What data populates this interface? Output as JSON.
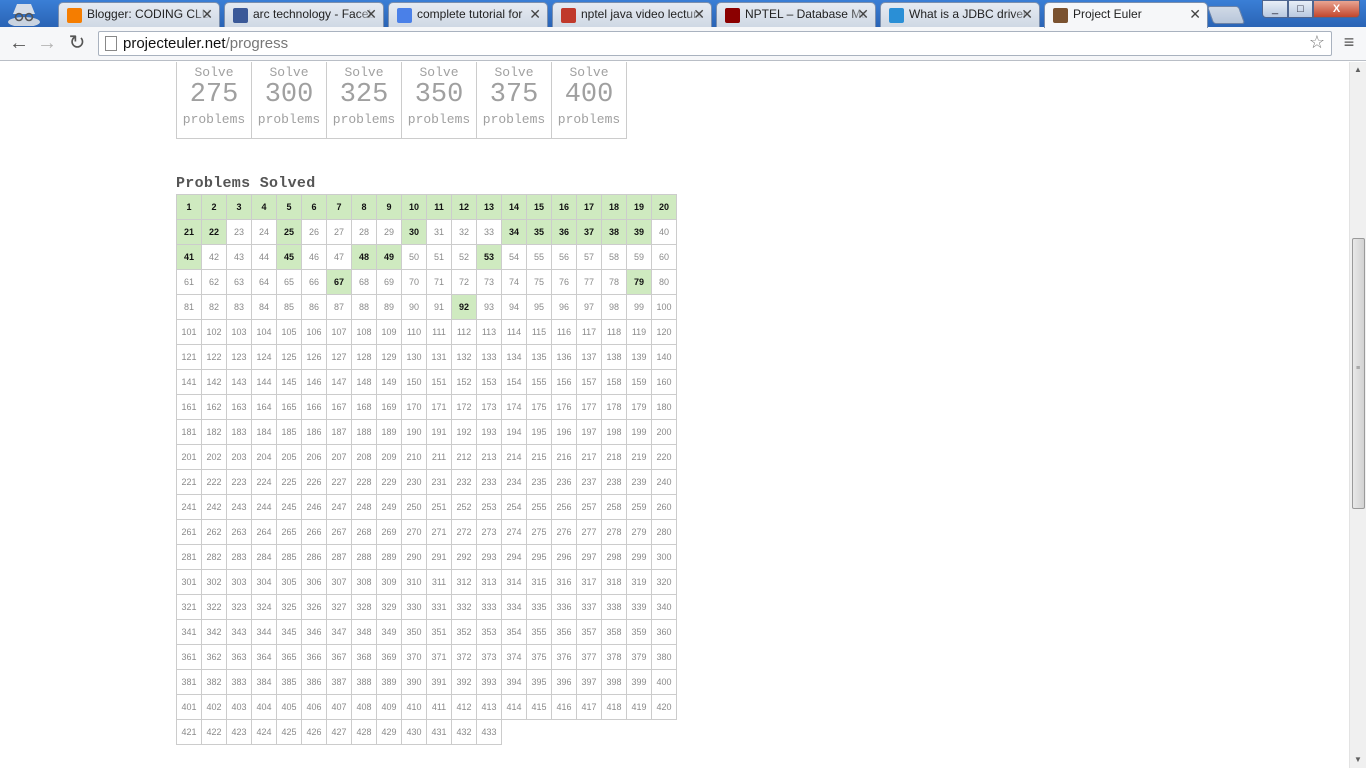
{
  "browser": {
    "tabs": [
      {
        "title": "Blogger: CODING CLUB",
        "favicon": "blogger-icon",
        "color": "#f57d00",
        "active": false
      },
      {
        "title": "arc technology - Facebook",
        "favicon": "facebook-icon",
        "color": "#3b5998",
        "active": false
      },
      {
        "title": "complete tutorial for",
        "favicon": "google-icon",
        "color": "#4a80e8",
        "active": false
      },
      {
        "title": "nptel java video lecture",
        "favicon": "video-icon",
        "color": "#c0392b",
        "active": false
      },
      {
        "title": "NPTEL – Database Management",
        "favicon": "nptel-icon",
        "color": "#8b0000",
        "active": false
      },
      {
        "title": "What is a JDBC driver",
        "favicon": "cloud-icon",
        "color": "#2a8fd6",
        "active": false
      },
      {
        "title": "Project Euler",
        "favicon": "project-euler-icon",
        "color": "#7a5230",
        "active": true
      }
    ],
    "tab_close_glyph": "✕",
    "url_host": "projecteuler.net",
    "url_path": "/progress",
    "back_glyph": "←",
    "forward_glyph": "→",
    "reload_glyph": "↻",
    "star_glyph": "☆",
    "menu_glyph": "≡",
    "window": {
      "minimize": "_",
      "maximize": "□",
      "close": "X"
    }
  },
  "milestones": [
    {
      "label_top": "Solve",
      "number": "275",
      "label_bottom": "problems"
    },
    {
      "label_top": "Solve",
      "number": "300",
      "label_bottom": "problems"
    },
    {
      "label_top": "Solve",
      "number": "325",
      "label_bottom": "problems"
    },
    {
      "label_top": "Solve",
      "number": "350",
      "label_bottom": "problems"
    },
    {
      "label_top": "Solve",
      "number": "375",
      "label_bottom": "problems"
    },
    {
      "label_top": "Solve",
      "number": "400",
      "label_bottom": "problems"
    }
  ],
  "problems": {
    "heading": "Problems Solved",
    "total": 433,
    "columns": 20,
    "solved": [
      1,
      2,
      3,
      4,
      5,
      6,
      7,
      8,
      9,
      10,
      11,
      12,
      13,
      14,
      15,
      16,
      17,
      18,
      19,
      20,
      21,
      22,
      25,
      30,
      34,
      35,
      36,
      37,
      38,
      39,
      41,
      45,
      48,
      49,
      53,
      67,
      79,
      92
    ],
    "solved_color": "#cfeac0"
  }
}
